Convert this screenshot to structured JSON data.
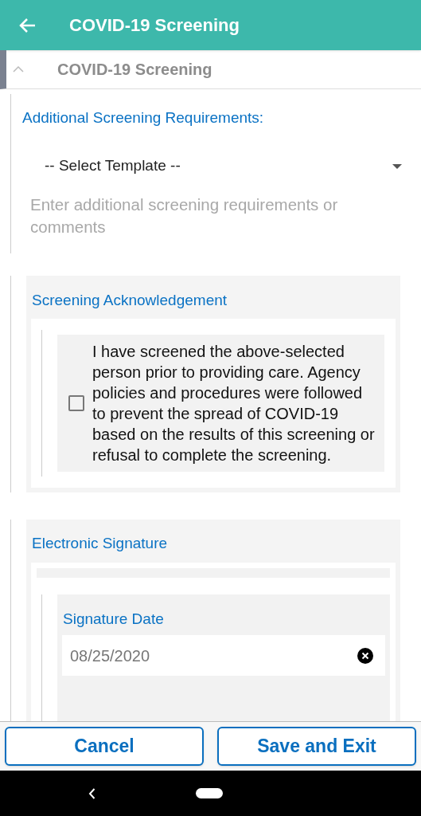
{
  "app_bar": {
    "title": "COVID-19 Screening"
  },
  "section": {
    "title": "COVID-19 Screening",
    "expanded": true
  },
  "requirements": {
    "label": "Additional Screening Requirements:",
    "template_select": "-- Select Template --",
    "comments_placeholder": "Enter additional screening requirements or comments"
  },
  "acknowledgement": {
    "title": "Screening Acknowledgement",
    "checkbox_label": "I have screened the above-selected person prior to providing care. Agency policies and procedures were followed to prevent the spread of COVID-19 based on the results of this screening or refusal to complete the screening.",
    "checked": false
  },
  "signature": {
    "title": "Electronic Signature",
    "date_label": "Signature Date",
    "date_value": "08/25/2020"
  },
  "buttons": [
    "Cancel",
    "Save and Exit"
  ]
}
